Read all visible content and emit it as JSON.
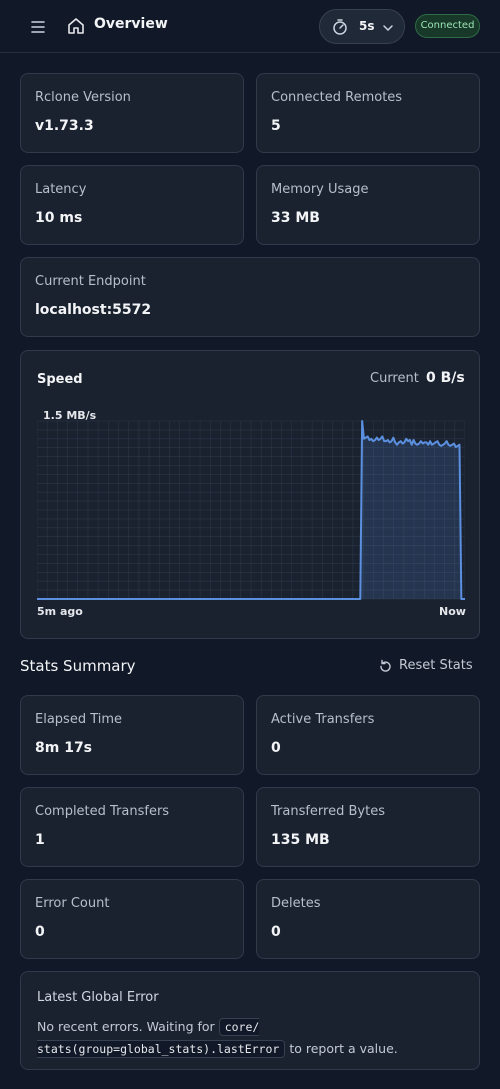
{
  "header": {
    "title": "Overview",
    "refresh_interval": "5s",
    "status": "Connected",
    "icons": [
      "menu-icon",
      "home-icon",
      "timer-icon",
      "chevron-down-icon"
    ]
  },
  "info_cards": [
    {
      "label": "Rclone Version",
      "value": "v1.73.3"
    },
    {
      "label": "Connected Remotes",
      "value": "5"
    },
    {
      "label": "Latency",
      "value": "10 ms"
    },
    {
      "label": "Memory Usage",
      "value": "33 MB"
    },
    {
      "label": "Current Endpoint",
      "value": "localhost:5572"
    }
  ],
  "speed_chart": {
    "title": "Speed",
    "current_label": "Current",
    "current_value": "0 B/s",
    "y_max_label": "1.5 MB/s",
    "x_start_label": "5m ago",
    "x_end_label": "Now"
  },
  "chart_data": {
    "type": "area",
    "title": "Speed",
    "ylabel": "",
    "xlabel": "",
    "y_unit": "MB/s",
    "ylim": [
      0,
      1.5
    ],
    "grid": true,
    "x_range_labels": [
      "5m ago",
      "Now"
    ],
    "series": [
      {
        "values": [
          0,
          0,
          0,
          0,
          0,
          0,
          0,
          0,
          0,
          0,
          0,
          0,
          0,
          0,
          0,
          0,
          0,
          0,
          0,
          0,
          0,
          0,
          0,
          0,
          0,
          0,
          0,
          0,
          0,
          0,
          0,
          0,
          0,
          0,
          0,
          0,
          0,
          0,
          0,
          0,
          0,
          0,
          0,
          0,
          0,
          0,
          0,
          0,
          0,
          0,
          0,
          0,
          0,
          0,
          0,
          0,
          0,
          0,
          0,
          0,
          0,
          0,
          0,
          0,
          0,
          0,
          0,
          0,
          0,
          0,
          0,
          0,
          0,
          0,
          0,
          0,
          0,
          0,
          0,
          0,
          0,
          0,
          0,
          0,
          0,
          0,
          0,
          0,
          0,
          0,
          0,
          0,
          0,
          0,
          0,
          0,
          0,
          0,
          0,
          0,
          0,
          0,
          0,
          0,
          0,
          0,
          0,
          0,
          0,
          0,
          0,
          0,
          0,
          0,
          0,
          0,
          0,
          0,
          0,
          0,
          0,
          0,
          0,
          0,
          0,
          0,
          0,
          0,
          0,
          0,
          0,
          0,
          0,
          0,
          0,
          0,
          0,
          0,
          0,
          0,
          0,
          0,
          0,
          0,
          0,
          0,
          0,
          0,
          0,
          0,
          0,
          0,
          0,
          0,
          0,
          0,
          0,
          0,
          0,
          0,
          0,
          0,
          0,
          0,
          0,
          0,
          0,
          0,
          0,
          0,
          0,
          0,
          0,
          0,
          0,
          0,
          0,
          1.5,
          1.35,
          1.36,
          1.37,
          1.34,
          1.35,
          1.33,
          1.34,
          1.36,
          1.34,
          1.35,
          1.37,
          1.33,
          1.33,
          1.34,
          1.32,
          1.33,
          1.36,
          1.32,
          1.3,
          1.32,
          1.33,
          1.31,
          1.32,
          1.35,
          1.33,
          1.34,
          1.3,
          1.34,
          1.31,
          1.3,
          1.31,
          1.33,
          1.31,
          1.32,
          1.32,
          1.3,
          1.33,
          1.3,
          1.31,
          1.32,
          1.33,
          1.3,
          1.29,
          1.3,
          1.31,
          1.33,
          1.3,
          1.29,
          1.3,
          1.31,
          1.28,
          1.29,
          1.3,
          0,
          0,
          0
        ]
      }
    ]
  },
  "stats": {
    "title": "Stats Summary",
    "reset_label": "Reset Stats",
    "cards": [
      {
        "label": "Elapsed Time",
        "value": "8m 17s"
      },
      {
        "label": "Active Transfers",
        "value": "0"
      },
      {
        "label": "Completed Transfers",
        "value": "1"
      },
      {
        "label": "Transferred Bytes",
        "value": "135 MB"
      },
      {
        "label": "Error Count",
        "value": "0"
      },
      {
        "label": "Deletes",
        "value": "0"
      }
    ]
  },
  "latest_error": {
    "title": "Latest Global Error",
    "text_before": "No recent errors. Waiting for",
    "code": "core/ stats(group=global_stats).lastError",
    "text_after": "to report a value."
  },
  "colors": {
    "background": "#111827",
    "card": "#1a2230",
    "border": "#2f3a4b",
    "line": "#5b8fe0",
    "badge_bg": "#18392a",
    "badge_text": "#9be3b2"
  }
}
